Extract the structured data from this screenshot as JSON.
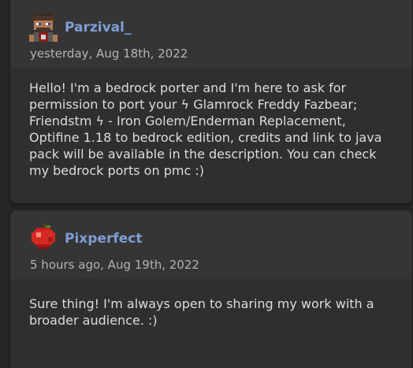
{
  "comments": [
    {
      "username": "Parzival_",
      "avatar_icon": "pixel-character-avatar-icon",
      "timestamp": "yesterday, Aug 18th, 2022",
      "message": "Hello! I'm a bedrock porter and I'm here to ask for\npermission to port your ϟ Glamrock Freddy Fazbear;\nFriendstm ϟ - Iron Golem/Enderman Replacement,\nOptifine 1.18 to bedrock edition, credits and link to java\npack will be available in the description. You can check\nmy bedrock ports on pmc :)"
    },
    {
      "username": "Pixperfect",
      "avatar_icon": "red-apple-avatar-icon",
      "timestamp": "5 hours ago, Aug 19th, 2022",
      "message": "Sure thing! I'm always open to sharing my work with a\nbroader audience. :)"
    }
  ],
  "colors": {
    "page_background": "#262626",
    "card_header": "#353535",
    "card_body": "#2f2f2f",
    "username": "#7f9ed4",
    "timestamp": "#b3b3b3",
    "message_text": "#dcdcdc"
  }
}
